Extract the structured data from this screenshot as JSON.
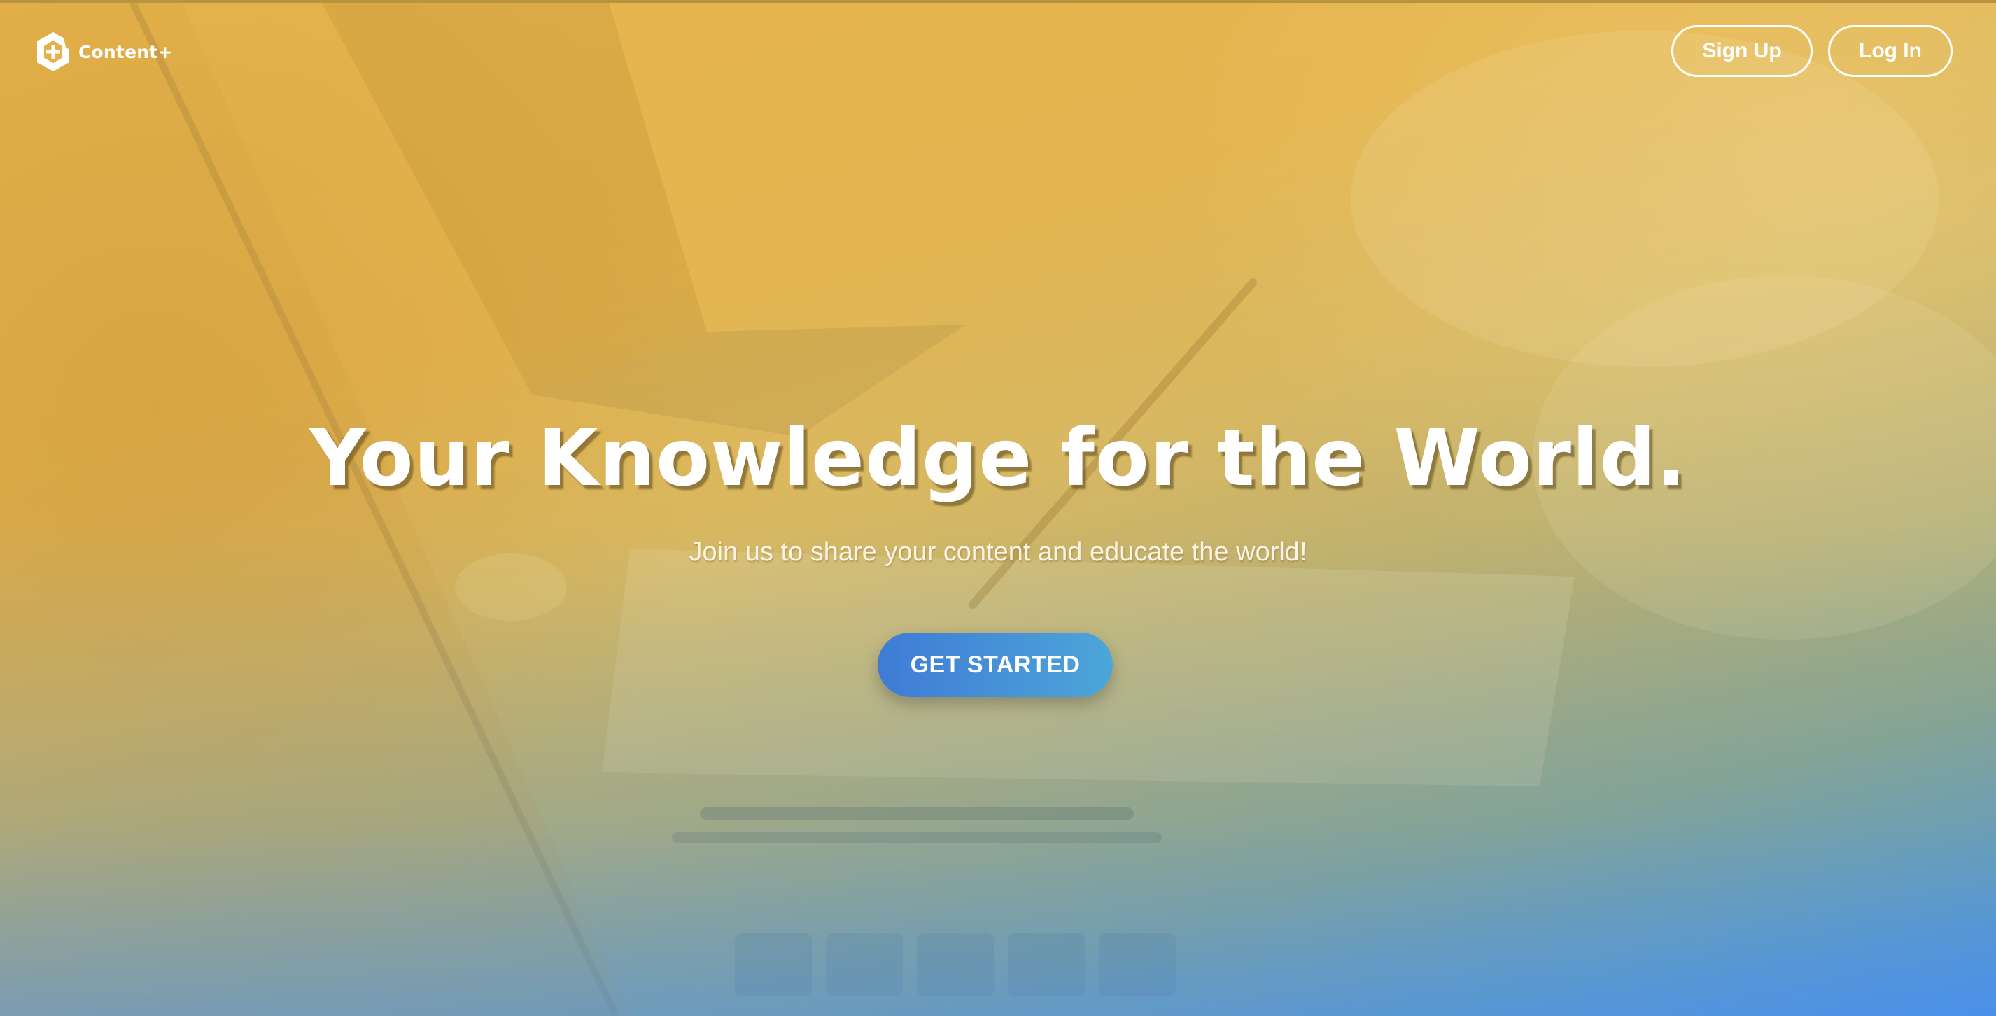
{
  "brand": {
    "name": "Content+",
    "icon": "hexagon-logo-icon"
  },
  "nav": {
    "signup_label": "Sign Up",
    "login_label": "Log In"
  },
  "hero": {
    "headline": "Your Knowledge for the World.",
    "subheadline": "Join us to share your content and educate the world!",
    "cta_label": "GET STARTED"
  },
  "colors": {
    "gradient_top": "#e7b54c",
    "gradient_bottom": "#4a90ea",
    "cta_start": "#3f7bd6",
    "cta_end": "#4ca6d8",
    "text": "#ffffff"
  }
}
